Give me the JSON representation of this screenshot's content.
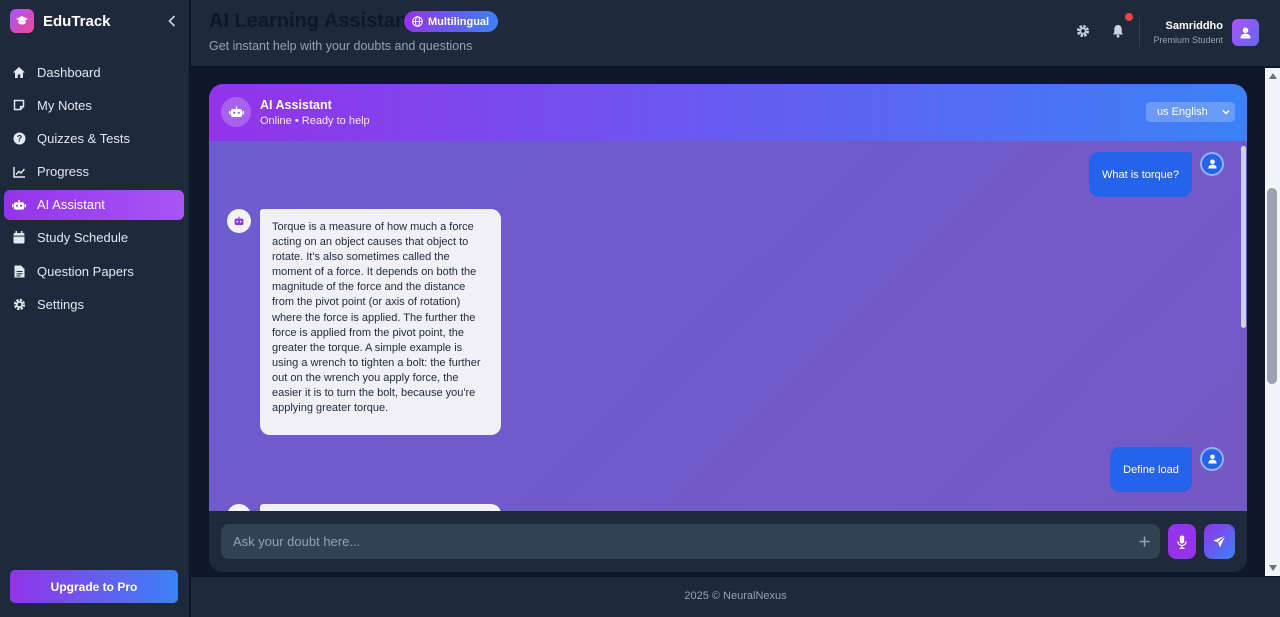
{
  "app": {
    "name": "EduTrack"
  },
  "sidebar": {
    "items": [
      {
        "label": "Dashboard",
        "icon": "home-icon"
      },
      {
        "label": "My Notes",
        "icon": "note-icon"
      },
      {
        "label": "Quizzes & Tests",
        "icon": "question-icon"
      },
      {
        "label": "Progress",
        "icon": "chart-line-icon"
      },
      {
        "label": "AI Assistant",
        "icon": "robot-icon",
        "active": true
      },
      {
        "label": "Study Schedule",
        "icon": "calendar-icon"
      },
      {
        "label": "Question Papers",
        "icon": "file-icon"
      },
      {
        "label": "Settings",
        "icon": "gear-icon"
      }
    ],
    "upgrade_label": "Upgrade to Pro"
  },
  "header": {
    "title": "AI Learning Assistant",
    "badge": "Multilingual",
    "subtitle": "Get instant help with your doubts and questions",
    "user": {
      "name": "Samriddho",
      "role": "Premium Student"
    }
  },
  "chat": {
    "assistant_name": "AI Assistant",
    "status": "Online • Ready to help",
    "language": "us English",
    "messages": [
      {
        "from": "user",
        "text": "What is torque?"
      },
      {
        "from": "bot",
        "text": "Torque is a measure of how much a force acting on an object causes that object to rotate. It's also sometimes called the moment of a force. It depends on both the magnitude of the force and the distance from the pivot point (or axis of rotation) where the force is applied. The further the force is applied from the pivot point, the greater the torque. A simple example is using a wrench to tighten a bolt: the further out on the wrench you apply force, the easier it is to turn the bolt, because you're applying greater torque."
      },
      {
        "from": "user",
        "text": "Define load"
      }
    ],
    "input_placeholder": "Ask your doubt here..."
  },
  "footer": {
    "text": "2025 © NeuralNexus"
  },
  "colors": {
    "accent_purple": "#9333ea",
    "accent_blue": "#3b82f6",
    "notification": "#ef4444"
  }
}
